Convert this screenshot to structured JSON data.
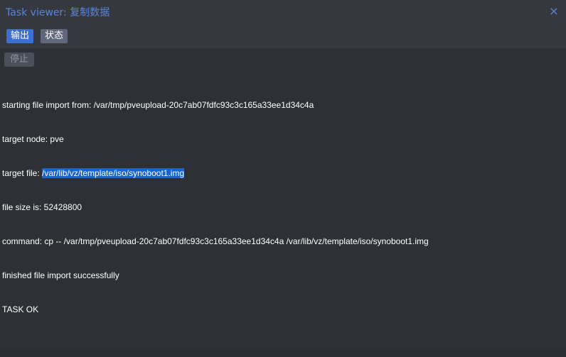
{
  "window": {
    "title": "Task viewer: 复制数据",
    "close_glyph": "×"
  },
  "tabs": [
    {
      "label": "输出",
      "active": true
    },
    {
      "label": "状态",
      "active": false
    }
  ],
  "toolbar": {
    "stop_label": "停止",
    "stop_disabled": true
  },
  "log": {
    "lines": [
      {
        "text": "starting file import from: /var/tmp/pveupload-20c7ab07fdfc93c3c165a33ee1d34c4a"
      },
      {
        "text": "target node: pve"
      },
      {
        "prefix": "target file: ",
        "selected": "/var/lib/vz/template/iso/synoboot1.img"
      },
      {
        "text": "file size is: 52428800"
      },
      {
        "text": "command: cp -- /var/tmp/pveupload-20c7ab07fdfc93c3c165a33ee1d34c4a /var/lib/vz/template/iso/synoboot1.img"
      },
      {
        "text": "finished file import successfully"
      },
      {
        "text": "TASK OK"
      }
    ]
  },
  "colors": {
    "accent": "#5b83d7",
    "tab_active": "#3b6fd0",
    "selection": "#1a63c9",
    "background": "#2d3035"
  }
}
